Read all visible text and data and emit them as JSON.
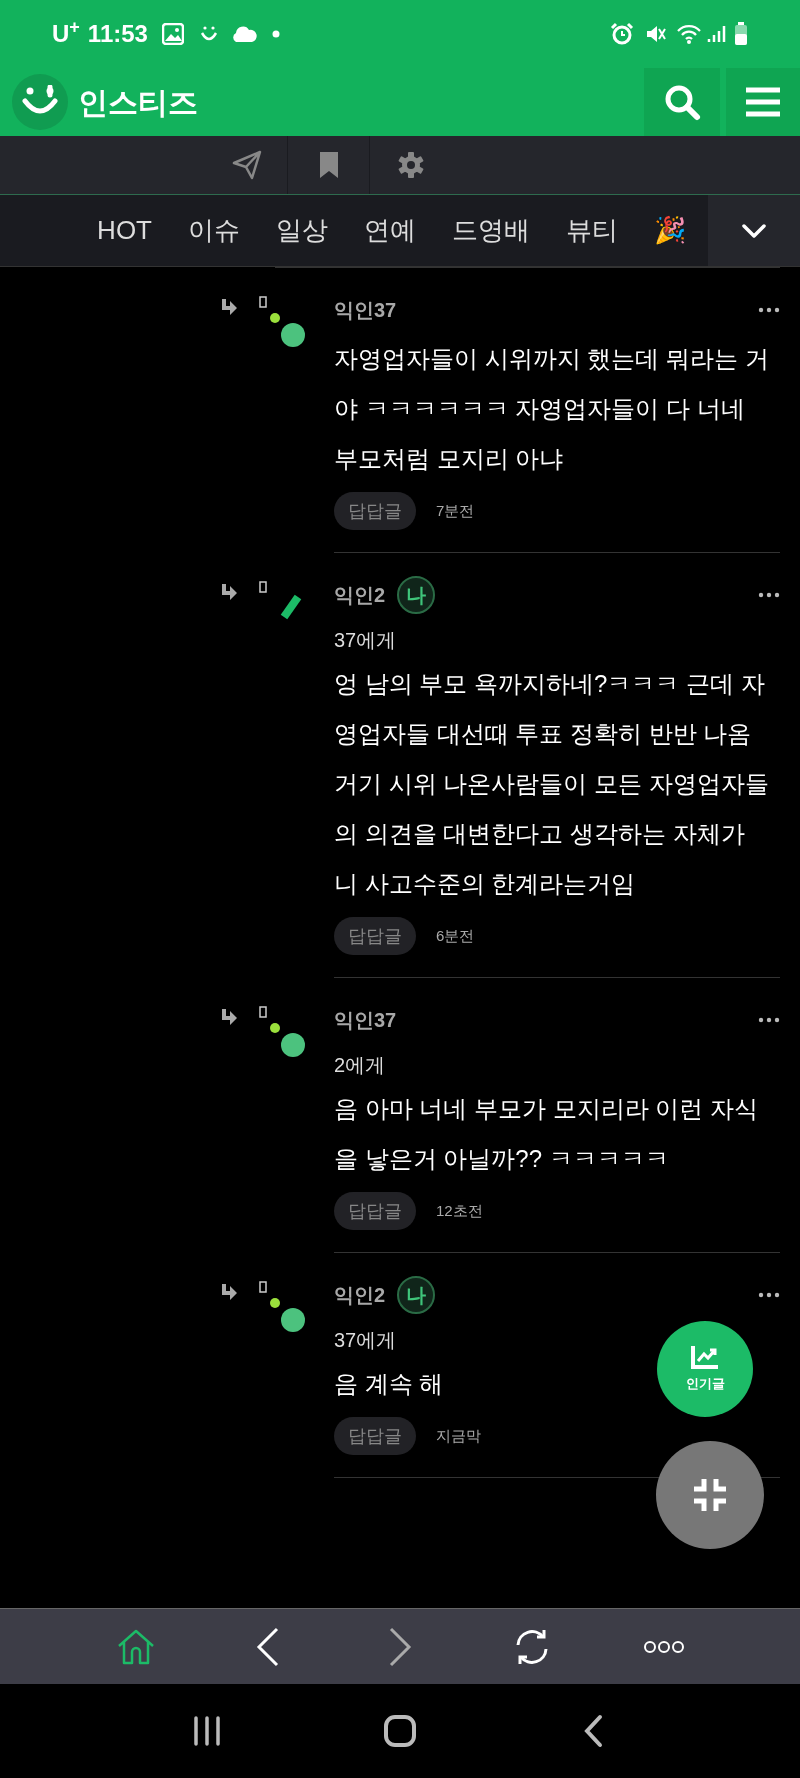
{
  "status_bar": {
    "carrier": "U$^{+}$",
    "time": "11:53"
  },
  "header": {
    "site_name": "인스티즈"
  },
  "categories": [
    "HOT",
    "이슈",
    "일상",
    "연예",
    "드영배",
    "뷰티",
    "🎉"
  ],
  "comments": [
    {
      "author": "익인37",
      "kind": "dots",
      "text": "자영업자들이 시위까지 했는데 뭐라는 거야 ㅋㅋㅋㅋㅋㅋ 자영업자들이 다 너네 부모처럼 모지리 아냐",
      "reply_label": "답답글",
      "time": "7분전"
    },
    {
      "author": "익인2",
      "badge": "나",
      "kind": "slash",
      "recipient": "37에게",
      "text": "엉 남의 부모 욕까지하네?ㅋㅋㅋ 근데 자영업자들 대선때 투표 정확히 반반 나옴 거기 시위 나온사람들이 모든 자영업자들의 의견을 대변한다고 생각하는 자체가 니 사고수준의 한계라는거임",
      "reply_label": "답답글",
      "time": "6분전"
    },
    {
      "author": "익인37",
      "kind": "dots",
      "recipient": "2에게",
      "text": "음 아마 너네 부모가 모지리라 이런 자식을 낳은거 아닐까?? ㅋㅋㅋㅋㅋ",
      "reply_label": "답답글",
      "time": "12초전"
    },
    {
      "author": "익인2",
      "badge": "나",
      "kind": "dots",
      "recipient": "37에게",
      "text": "음 계속 해",
      "reply_label": "답답글",
      "time": "지금막"
    }
  ],
  "fab": {
    "label": "인기글"
  },
  "browser_bar": {
    "home_selected": true
  }
}
